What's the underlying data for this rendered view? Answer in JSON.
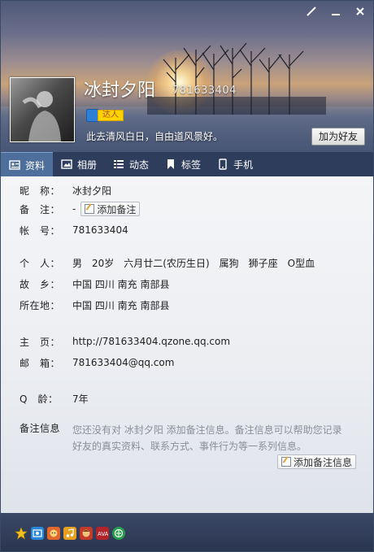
{
  "header": {
    "nickname": "冰封夕阳",
    "qq_number": "781633404",
    "badge_label": "达人",
    "signature": "此去清风白日，自由道风景好。",
    "add_friend_label": "加为好友"
  },
  "window_controls": {
    "skin_icon": "brush-icon",
    "minimize_icon": "minimize-icon",
    "close_icon": "close-icon"
  },
  "tabs": [
    {
      "label": "资料",
      "icon": "profile-card-icon",
      "active": true
    },
    {
      "label": "相册",
      "icon": "photo-album-icon",
      "active": false
    },
    {
      "label": "动态",
      "icon": "feed-list-icon",
      "active": false
    },
    {
      "label": "标签",
      "icon": "bookmark-icon",
      "active": false
    },
    {
      "label": "手机",
      "icon": "phone-icon",
      "active": false
    }
  ],
  "profile": {
    "nickname_label": "昵　称：",
    "nickname_value": "冰封夕阳",
    "remark_label": "备　注：",
    "remark_value": "-",
    "add_remark_label": "添加备注",
    "account_label": "帐　号：",
    "account_value": "781633404",
    "personal_label": "个　人：",
    "personal_value": "男　20岁　六月廿二(农历生日)　属狗　狮子座　O型血",
    "hometown_label": "故　乡：",
    "hometown_value": "中国 四川 南充 南部县",
    "location_label": "所在地：",
    "location_value": "中国 四川 南充 南部县",
    "homepage_label": "主　页：",
    "homepage_value": "http://781633404.qzone.qq.com",
    "email_label": "邮　箱：",
    "email_value": "781633404@qq.com",
    "qage_label": "Q　龄：",
    "qage_value": "7年",
    "remark_info_label": "备注信息",
    "remark_info_text": "您还没有对 冰封夕阳 添加备注信息。备注信息可以帮助您记录好友的真实资料、联系方式、事件行为等一系列信息。",
    "add_remark_info_label": "添加备注信息"
  },
  "bottom_icons": [
    {
      "name": "favorite-star-icon",
      "color": "#f3c01c"
    },
    {
      "name": "qq-show-icon",
      "color": "#2a86d8"
    },
    {
      "name": "pet-icon",
      "color": "#e0682c"
    },
    {
      "name": "music-icon",
      "color": "#e8a020"
    },
    {
      "name": "game-icon",
      "color": "#c23a2a"
    },
    {
      "name": "ava-icon",
      "color": "#b0242a"
    },
    {
      "name": "browser-icon",
      "color": "#27a04b"
    }
  ],
  "colors": {
    "tabbar_bg": "#2f3d5c",
    "tab_active_bg": "#4e6e9c",
    "bottom_bg": "#2a3550"
  }
}
